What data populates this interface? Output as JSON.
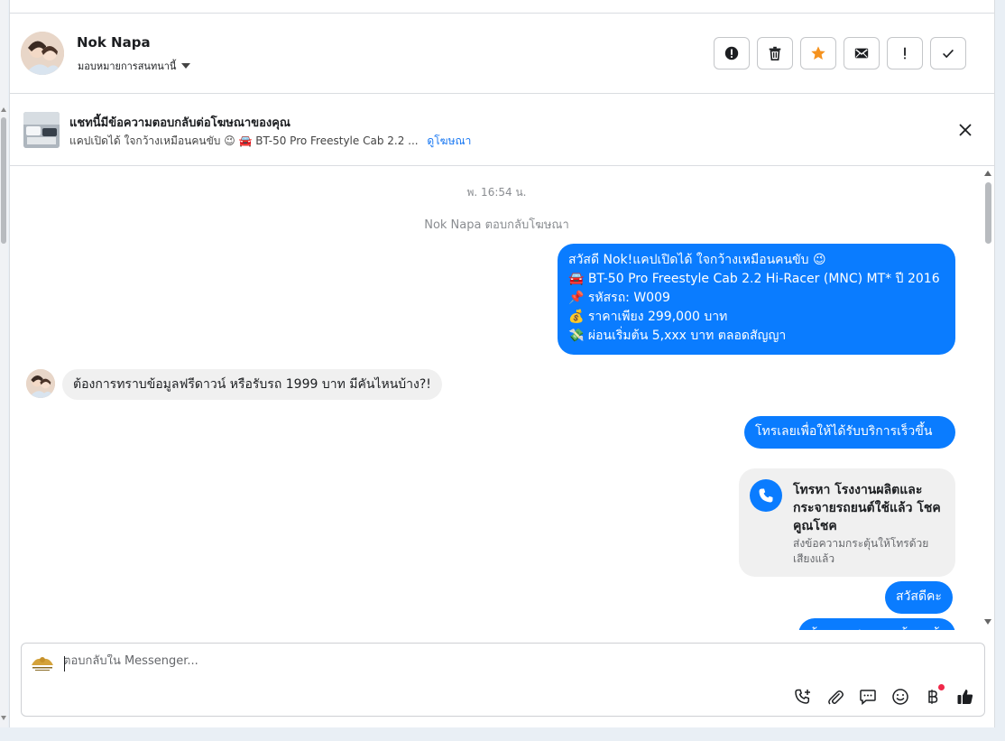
{
  "contact": {
    "name": "Nok Napa",
    "assign_label": "มอบหมายการสนทนานี้"
  },
  "header_actions": [
    {
      "name": "spam-alert-button",
      "icon": "alert-circle-icon"
    },
    {
      "name": "delete-button",
      "icon": "trash-icon"
    },
    {
      "name": "star-button",
      "icon": "star-icon"
    },
    {
      "name": "mark-unread-button",
      "icon": "envelope-icon"
    },
    {
      "name": "follow-up-button",
      "icon": "exclamation-icon"
    },
    {
      "name": "mark-done-button",
      "icon": "check-icon"
    }
  ],
  "ad_banner": {
    "title": "แชทนี้มีข้อความตอบกลับต่อโฆษณาของคุณ",
    "subtitle": "แคปเปิดได้ ใจกว้างเหมือนคนขับ 😉 🚘 BT-50 Pro Freestyle Cab 2.2 ...",
    "link": "ดูโฆษณา"
  },
  "conversation": {
    "timestamp": "พ. 16:54 น.",
    "system_note": "Nok Napa ตอบกลับโฆษณา",
    "outgoing_ad_message": [
      "สวัสดี Nok!แคปเปิดได้ ใจกว้างเหมือนคนขับ 😉",
      "🚘 BT-50 Pro Freestyle Cab 2.2 Hi-Racer (MNC) MT* ปี 2016",
      "📌 รหัสรถ: W009",
      "💰 ราคาเพียง 299,000 บาท",
      "💸 ผ่อนเริ่มต้น 5,xxx บาท ตลอดสัญญา"
    ],
    "incoming_message": "ต้องการทราบข้อมูลฟรีดาวน์ หรือรับรถ 1999 บาท มีคันไหนบ้าง?!",
    "outgoing_call_prompt": "โทรเลยเพื่อให้ได้รับบริการเร็วขึ้น",
    "call_card": {
      "title": "โทรหา โรงงานผลิตและกระจายรถยนต์ใช้แล้ว โชคคูณโชค",
      "subtitle": "ส่งข้อความกระตุ้นให้โทรด้วยเสียงแล้ว"
    },
    "outgoing_greeting": "สวัสดีคะ",
    "outgoing_partial": "ต้องการสอบถามข้อมูลด้านไหน"
  },
  "composer": {
    "placeholder": "ตอบกลับใน Messenger..."
  },
  "colors": {
    "accent": "#0a7cff",
    "star": "#f5921e",
    "notify_dot": "#f02849"
  }
}
